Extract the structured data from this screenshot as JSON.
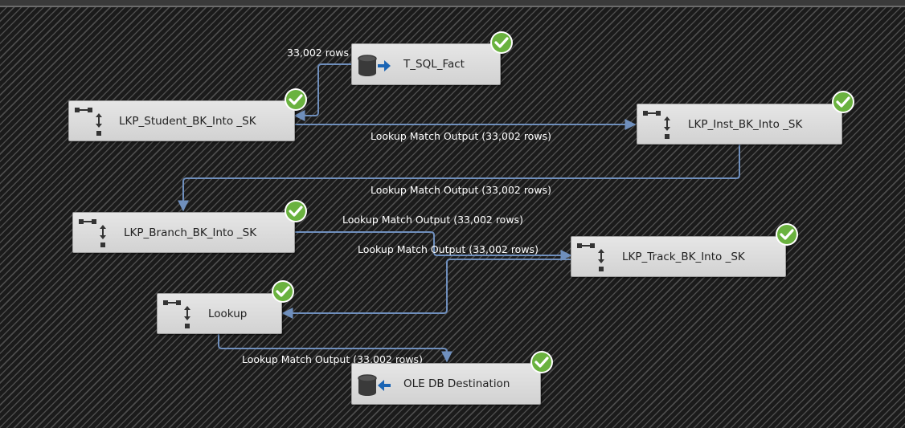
{
  "nodes": {
    "t_sql_fact": {
      "label": "T_SQL_Fact",
      "icon": "source-database-icon"
    },
    "lkp_student": {
      "label": "LKP_Student_BK_Into _SK",
      "icon": "lookup-icon"
    },
    "lkp_inst": {
      "label": "LKP_Inst_BK_Into _SK",
      "icon": "lookup-icon"
    },
    "lkp_branch": {
      "label": "LKP_Branch_BK_Into _SK",
      "icon": "lookup-icon"
    },
    "lkp_track": {
      "label": "LKP_Track_BK_Into _SK",
      "icon": "lookup-icon"
    },
    "lookup": {
      "label": "Lookup",
      "icon": "lookup-icon"
    },
    "ole_db_destination": {
      "label": "OLE DB Destination",
      "icon": "destination-database-icon"
    }
  },
  "edges": {
    "fact_to_student": "33,002 rows",
    "student_to_inst": "Lookup Match Output (33,002 rows)",
    "inst_to_branch": "Lookup Match Output (33,002 rows)",
    "branch_to_track": "Lookup Match Output (33,002 rows)",
    "track_to_lookup": "Lookup Match Output (33,002 rows)",
    "lookup_to_destination": "Lookup Match Output (33,002 rows)"
  },
  "status": {
    "icon": "success-check-icon",
    "color": "#6ab23f"
  },
  "colors": {
    "wire": "#6f8fbd",
    "background": "#1b1b1b"
  }
}
